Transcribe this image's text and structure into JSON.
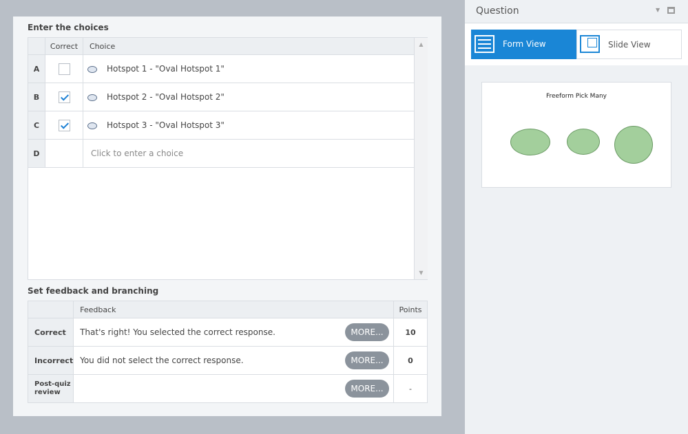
{
  "choices_section": {
    "title": "Enter the choices",
    "headers": {
      "correct": "Correct",
      "choice": "Choice"
    },
    "rows": [
      {
        "letter": "A",
        "correct": false,
        "text": "Hotspot 1 - \"Oval Hotspot 1\""
      },
      {
        "letter": "B",
        "correct": true,
        "text": "Hotspot 2 - \"Oval Hotspot 2\""
      },
      {
        "letter": "C",
        "correct": true,
        "text": "Hotspot 3 - \"Oval Hotspot 3\""
      }
    ],
    "new_row": {
      "letter": "D",
      "placeholder": "Click to enter a choice"
    }
  },
  "feedback_section": {
    "title": "Set feedback and branching",
    "headers": {
      "feedback": "Feedback",
      "points": "Points"
    },
    "rows": [
      {
        "label": "Correct",
        "text": "That's right!  You selected the correct response.",
        "button": "MORE...",
        "points": "10"
      },
      {
        "label": "Incorrect",
        "text": "You did not select the correct response.",
        "button": "MORE...",
        "points": "0"
      },
      {
        "label": "Post-quiz review",
        "text": "",
        "button": "MORE...",
        "points": "-"
      }
    ]
  },
  "right_panel": {
    "title": "Question",
    "tabs": [
      {
        "label": "Form View",
        "active": true
      },
      {
        "label": "Slide View",
        "active": false
      }
    ],
    "preview_title": "Freeform Pick Many"
  },
  "colors": {
    "accent": "#1a86d6",
    "oval_fill": "#a3cf9c"
  }
}
